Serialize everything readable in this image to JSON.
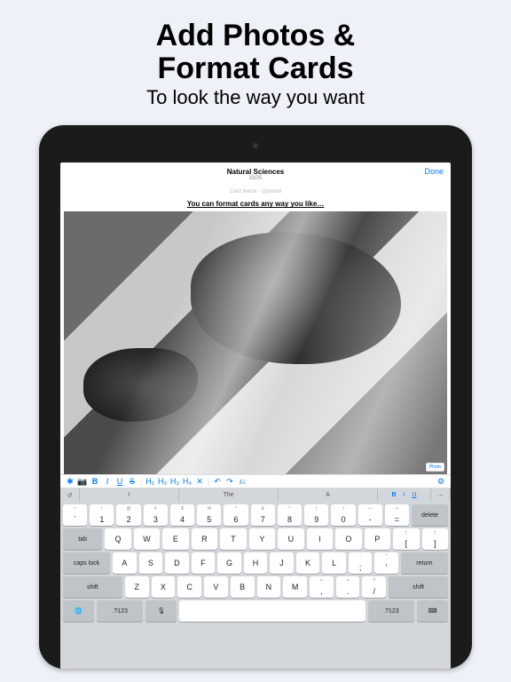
{
  "promo": {
    "headline1": "Add Photos &",
    "headline2": "Format Cards",
    "sub": "To look the way you want"
  },
  "header": {
    "title": "Natural Sciences",
    "subtitle": "33/25",
    "done": "Done",
    "sectionHint": "Card Name · Optional",
    "caption": "You can format cards any way you like…",
    "photoBadge": "Photo"
  },
  "toolbar": {
    "i0": "✱",
    "i1": "📷",
    "i2": "B",
    "i3": "I",
    "i4": "U",
    "i5": "S",
    "i6": "H₁",
    "i7": "H₂",
    "i8": "H₃",
    "i9": "H₄",
    "i10": "✕",
    "i11": "↶",
    "i12": "↷",
    "i13": "⎌",
    "i14": "⚙"
  },
  "quickbar": {
    "undo": "I",
    "word": "The",
    "sugg": "A",
    "b": "B",
    "it": "I",
    "u": "U"
  },
  "rows": {
    "num": [
      {
        "s": "!",
        "m": "1"
      },
      {
        "s": "@",
        "m": "2"
      },
      {
        "s": "#",
        "m": "3"
      },
      {
        "s": "$",
        "m": "4"
      },
      {
        "s": "%",
        "m": "5"
      },
      {
        "s": "^",
        "m": "6"
      },
      {
        "s": "&",
        "m": "7"
      },
      {
        "s": "*",
        "m": "8"
      },
      {
        "s": "(",
        "m": "9"
      },
      {
        "s": ")",
        "m": "0"
      },
      {
        "s": "—",
        "m": "-"
      },
      {
        "s": "+",
        "m": "="
      }
    ],
    "r1": [
      "Q",
      "W",
      "E",
      "R",
      "T",
      "Y",
      "U",
      "I",
      "O",
      "P"
    ],
    "r1b": [
      {
        "s": "{",
        "m": "["
      },
      {
        "s": "}",
        "m": "]"
      }
    ],
    "r2": [
      "A",
      "S",
      "D",
      "F",
      "G",
      "H",
      "J",
      "K",
      "L"
    ],
    "r2b": [
      {
        "s": ":",
        "m": ";"
      },
      {
        "s": "\"",
        "m": "'"
      }
    ],
    "r3": [
      "Z",
      "X",
      "C",
      "V",
      "B",
      "N",
      "M"
    ],
    "r3b": [
      {
        "s": "<",
        "m": ","
      },
      {
        "s": ">",
        "m": "."
      },
      {
        "s": "?",
        "m": "/"
      }
    ]
  },
  "mods": {
    "tilde": "~",
    "grave": "`",
    "delete": "delete",
    "tab": "tab",
    "capslock": "caps lock",
    "return": "return",
    "shift": "shift",
    "globe": "🌐",
    "numkey": ".?123",
    "mic": "🎙",
    "hide": "⌨"
  }
}
